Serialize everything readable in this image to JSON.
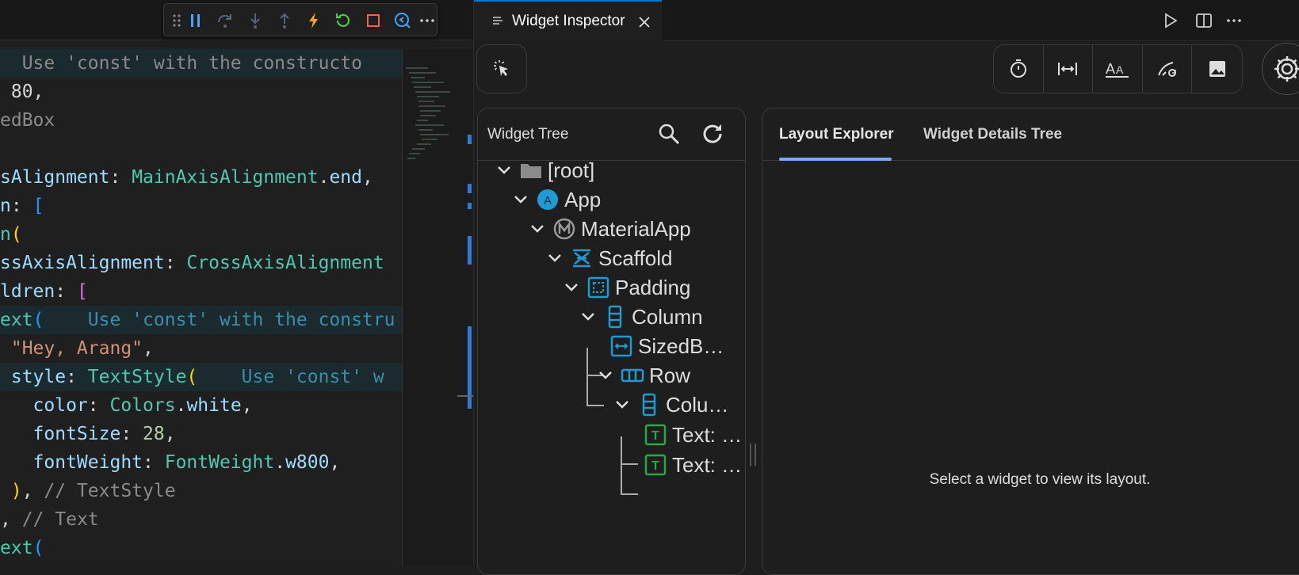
{
  "editor": {
    "lines": [
      {
        "parts": [
          [
            "c",
            "  Use 'const' with the constructo"
          ]
        ],
        "hl": true
      },
      {
        "parts": [
          [
            "p",
            " 80"
          ],
          [
            "p",
            ","
          ]
        ]
      },
      {
        "parts": [
          [
            "c",
            "edBox"
          ]
        ]
      },
      {
        "parts": [
          [
            "p",
            ""
          ]
        ]
      },
      {
        "parts": [
          [
            "k",
            "sAlignment"
          ],
          [
            "p",
            ": "
          ],
          [
            "t",
            "MainAxisAlignment"
          ],
          [
            "p",
            "."
          ],
          [
            "k",
            "end"
          ],
          [
            "p",
            ","
          ]
        ]
      },
      {
        "parts": [
          [
            "k",
            "n"
          ],
          [
            "p",
            ": "
          ],
          [
            "b",
            "["
          ]
        ]
      },
      {
        "parts": [
          [
            "t",
            "n"
          ],
          [
            "y",
            "("
          ]
        ]
      },
      {
        "parts": [
          [
            "k",
            "ssAxisAlignment"
          ],
          [
            "p",
            ": "
          ],
          [
            "t",
            "CrossAxisAlignment"
          ]
        ]
      },
      {
        "parts": [
          [
            "k",
            "ldren"
          ],
          [
            "p",
            ": "
          ],
          [
            "m",
            "["
          ]
        ]
      },
      {
        "parts": [
          [
            "t",
            "ext"
          ],
          [
            "b",
            "("
          ],
          [
            "h",
            "    Use 'const' with the constru"
          ]
        ],
        "hl": true
      },
      {
        "parts": [
          [
            "s",
            " \"Hey, Arang\""
          ],
          [
            "p",
            ","
          ]
        ]
      },
      {
        "parts": [
          [
            "k",
            " style"
          ],
          [
            "p",
            ": "
          ],
          [
            "t",
            "TextStyle"
          ],
          [
            "y",
            "("
          ],
          [
            "h",
            "    Use 'const' w"
          ]
        ],
        "hl": true
      },
      {
        "parts": [
          [
            "k",
            "   color"
          ],
          [
            "p",
            ": "
          ],
          [
            "t",
            "Colors"
          ],
          [
            "p",
            "."
          ],
          [
            "k",
            "white"
          ],
          [
            "p",
            ","
          ]
        ]
      },
      {
        "parts": [
          [
            "k",
            "   fontSize"
          ],
          [
            "p",
            ": "
          ],
          [
            "n",
            "28"
          ],
          [
            "p",
            ","
          ]
        ]
      },
      {
        "parts": [
          [
            "k",
            "   fontWeight"
          ],
          [
            "p",
            ": "
          ],
          [
            "t",
            "FontWeight"
          ],
          [
            "p",
            "."
          ],
          [
            "k",
            "w800"
          ],
          [
            "p",
            ","
          ]
        ]
      },
      {
        "parts": [
          [
            "y",
            " )"
          ],
          [
            "p",
            ", "
          ],
          [
            "c",
            "// TextStyle"
          ]
        ]
      },
      {
        "parts": [
          [
            "p",
            ", "
          ],
          [
            "c",
            "// Text"
          ]
        ]
      },
      {
        "parts": [
          [
            "t",
            "ext"
          ],
          [
            "b",
            "("
          ]
        ]
      }
    ]
  },
  "panel": {
    "tab_title": "Widget Inspector",
    "tree": {
      "title": "Widget Tree",
      "nodes": [
        {
          "label": "[root]",
          "icon": "folder-icon"
        },
        {
          "label": "App",
          "icon": "app-icon",
          "badge": "A"
        },
        {
          "label": "MaterialApp",
          "icon": "material-app-icon",
          "badge": "M"
        },
        {
          "label": "Scaffold",
          "icon": "scaffold-icon"
        },
        {
          "label": "Padding",
          "icon": "padding-icon"
        },
        {
          "label": "Column",
          "icon": "column-icon"
        },
        {
          "label": "SizedB…",
          "icon": "sized-box-icon"
        },
        {
          "label": "Row",
          "icon": "row-icon"
        },
        {
          "label": "Colu…",
          "icon": "column-icon"
        },
        {
          "label": "Text: …",
          "icon": "text-icon",
          "badge": "T"
        },
        {
          "label": "Text: …",
          "icon": "text-icon",
          "badge": "T"
        }
      ]
    },
    "layout": {
      "tabs": [
        "Layout Explorer",
        "Widget Details Tree"
      ],
      "empty_message": "Select a widget to view its layout."
    }
  },
  "colors": {
    "accent": "#0078d4",
    "tab_underline": "#7fa8ff",
    "widget_blue": "#1e9ad6",
    "text_green": "#27a844"
  }
}
